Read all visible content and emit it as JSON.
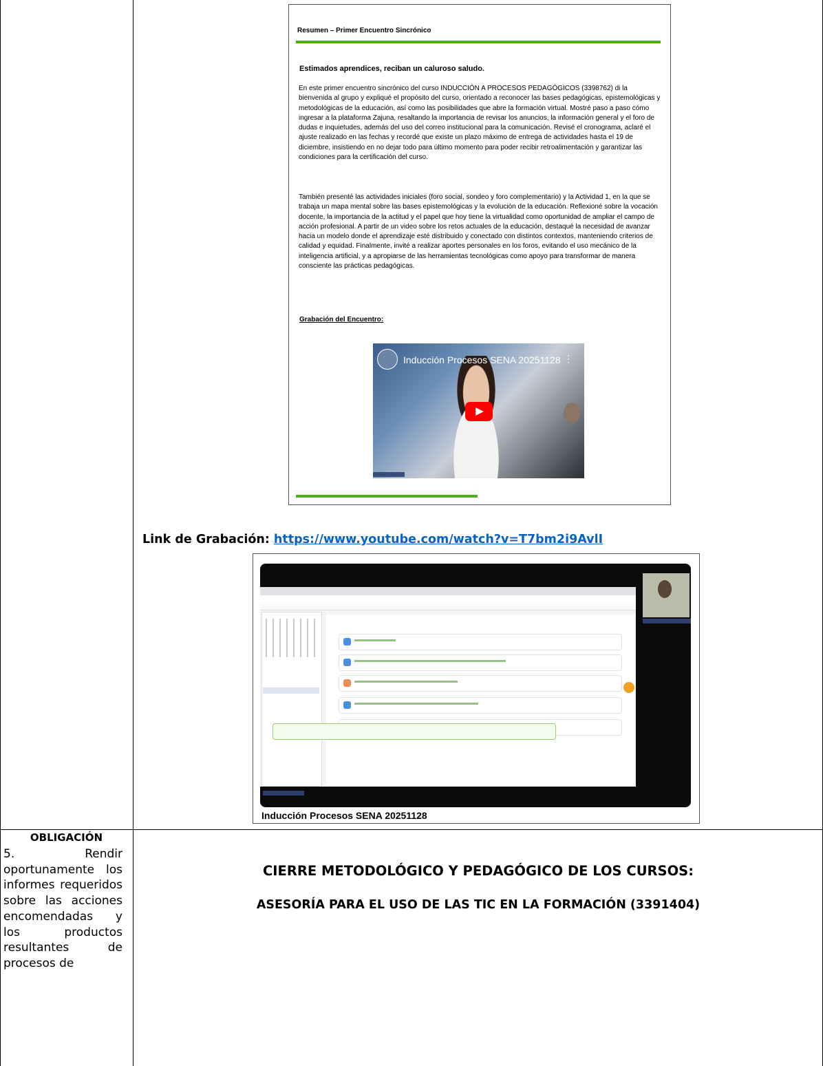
{
  "email": {
    "title": "Resumen – Primer Encuentro Sincrónico",
    "greeting": "Estimados aprendices, reciban un caluroso saludo.",
    "paragraph1": "En este primer encuentro sincrónico del curso INDUCCIÓN A PROCESOS PEDAGÓGICOS (3398762) di la bienvenida al grupo y expliqué el propósito del curso, orientado a reconocer las bases pedagógicas, epistemológicas y metodológicas de la educación, así como las posibilidades que abre la formación virtual. Mostré paso a paso cómo ingresar a la plataforma Zajuna, resaltando la importancia de revisar los anuncios, la información general y el foro de dudas e inquietudes, además del uso del correo institucional para la comunicación. Revisé el cronograma, aclaré el ajuste realizado en las fechas y recordé que existe un plazo máximo de entrega de actividades hasta el 19 de diciembre, insistiendo en no dejar todo para último momento para poder recibir retroalimentación y garantizar las condiciones para la certificación del curso.",
    "paragraph2": "También presenté las actividades iniciales (foro social, sondeo y foro complementario) y la Actividad 1, en la que se trabaja un mapa mental sobre las bases epistemológicas y la evolución de la educación. Reflexioné sobre la vocación docente, la importancia de la actitud y el papel que hoy tiene la virtualidad como oportunidad de ampliar el campo de acción profesional. A partir de un video sobre los retos actuales de la educación, destaqué la necesidad de avanzar hacia un modelo donde el aprendizaje esté distribuido y conectado con distintos contextos, manteniendo criterios de calidad y equidad. Finalmente, invité a realizar aportes personales en los foros, evitando el uso mecánico de la inteligencia artificial, y a apropiarse de las herramientas tecnológicas como apoyo para transformar de manera consciente las prácticas pedagógicas.",
    "recording_label": "Grabación del Encuentro:",
    "video_title": "Inducción Procesos SENA 20251128",
    "video_menu": "⋮"
  },
  "link": {
    "label": "Link de Grabación: ",
    "url": "https://www.youtube.com/watch?v=T7bm2i9AvlI"
  },
  "screenshot": {
    "caption": "Inducción Procesos SENA 20251128"
  },
  "obligation": {
    "title": "OBLIGACIÓN",
    "text": "5. Rendir oportunamente los informes requeridos sobre las acciones encomendadas y los productos resultantes de procesos de"
  },
  "closing": {
    "heading": "CIERRE METODOLÓGICO Y PEDAGÓGICO DE LOS CURSOS:",
    "subheading": "ASESORÍA PARA EL USO DE LAS TIC EN LA FORMACIÓN (3391404)"
  },
  "colors": {
    "accent_green": "#4caf1a",
    "link_blue": "#0563c1"
  }
}
